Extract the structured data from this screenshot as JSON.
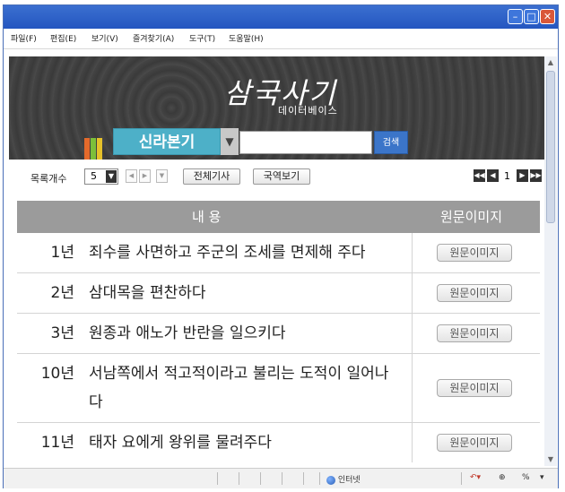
{
  "menu": {
    "items": [
      "파일(F)",
      "편집(E)",
      "보기(V)",
      "즐겨찾기(A)",
      "도구(T)",
      "도움말(H)"
    ]
  },
  "banner": {
    "logo_main": "삼국사기",
    "logo_sub": "데이터베이스",
    "book_tab": "신라본기",
    "search_button": "검색",
    "search_value": ""
  },
  "controls": {
    "count_label": "목록개수",
    "count_value": "5",
    "all_articles": "전체기사",
    "translation_view": "국역보기",
    "page": "1"
  },
  "table": {
    "header_content": "내 용",
    "header_image": "원문이미지",
    "button_label": "원문이미지",
    "rows": [
      {
        "year": "1년",
        "text": "죄수를 사면하고 주군의 조세를 면제해 주다"
      },
      {
        "year": "2년",
        "text": "삼대목을 편찬하다"
      },
      {
        "year": "3년",
        "text": "원종과 애노가 반란을 일으키다"
      },
      {
        "year": "10년",
        "text": "서남쪽에서 적고적이라고 불리는 도적이 일어나다"
      },
      {
        "year": "11년",
        "text": "태자 요에게 왕위를 물려주다"
      }
    ]
  },
  "status": {
    "zone": "인터넷",
    "zoom": "%"
  },
  "colors": {
    "titlebar": "#2456c0",
    "book_tab": "#4db0c8",
    "search_button": "#3b75c9",
    "table_header": "#9b9b9b"
  }
}
